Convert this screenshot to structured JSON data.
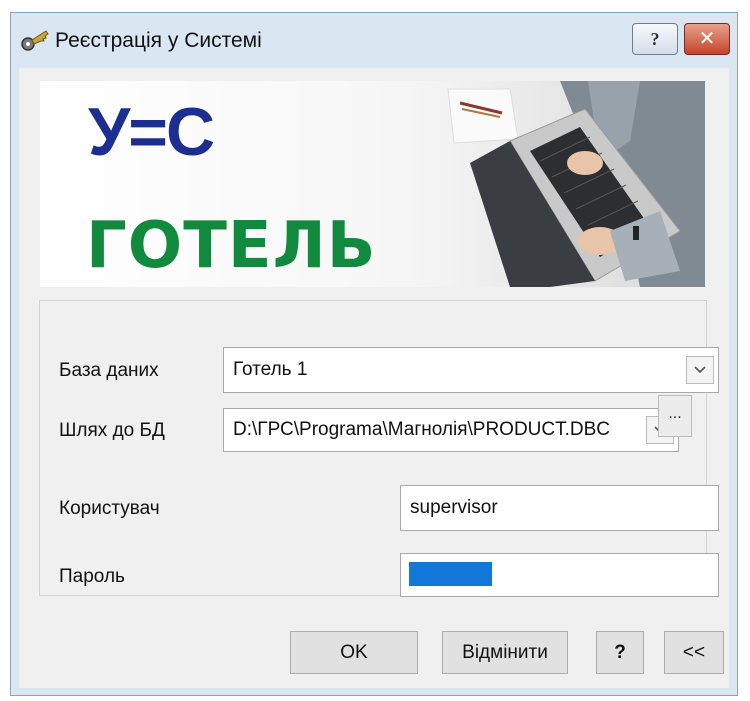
{
  "window": {
    "title": "Реєстрація у Системі",
    "help_label": "?",
    "close_label": "✕"
  },
  "banner": {
    "logo_text": "У=С",
    "product_name": "ГОТЕЛЬ"
  },
  "form": {
    "database_label": "База даних",
    "database_value": "Готель 1",
    "db_path_label": "Шлях до БД",
    "db_path_value": "D:\\ГРС\\Programa\\Магнолія\\PRODUCT.DBC",
    "browse_label": "...",
    "user_label": "Користувач",
    "user_value": "supervisor",
    "password_label": "Пароль"
  },
  "buttons": {
    "ok": "OK",
    "cancel": "Відмінити",
    "help": "?",
    "collapse": "<<"
  },
  "colors": {
    "logo_blue": "#1c2e8f",
    "logo_green": "#128a3e",
    "password_mask": "#1177d8"
  }
}
